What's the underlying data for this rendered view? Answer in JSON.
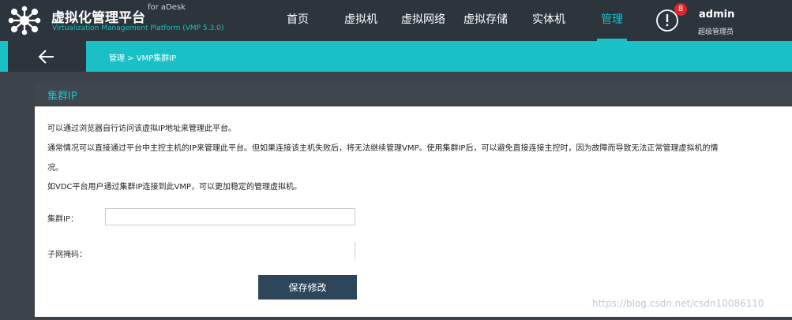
{
  "header": {
    "app_title": "虚拟化管理平台",
    "brand": "for aDesk",
    "subtitle": "Virtualization Management Platform (VMP 5.3.0)",
    "logo_icon": "network-hub-icon",
    "nav": [
      "首页",
      "虚拟机",
      "虚拟网络",
      "虚拟存储",
      "实体机",
      "管理"
    ],
    "active_nav": "管理",
    "alert_count": "8",
    "user_name": "admin",
    "user_role": "超级管理员"
  },
  "subheader": {
    "back_icon": "arrow-left-icon",
    "breadcrumb": "管理 > VMP集群IP"
  },
  "panel": {
    "title": "集群IP",
    "desc_lines": [
      "可以通过浏览器自行访问该虚拟IP地址来管理此平台。",
      "通常情况可以直接通过平台中主控主机的IP来管理此平台。但如果连接该主机失败后，将无法继续管理VMP。使用集群IP后，可以避免直接连接主控时，因为故障而导致无法正常管理虚拟机的情",
      "况。",
      "如VDC平台用户通过集群IP连接到此VMP，可以更加稳定的管理虚拟机。"
    ],
    "cluster_ip_label": "集群IP：",
    "cluster_ip_value": "",
    "netmask_label": "子网掩码：",
    "netmask_value": "",
    "save_label": "保存修改"
  },
  "watermark": "https://blog.csdn.net/csdn10086110",
  "colors": {
    "accent": "#19c1c7",
    "topbar": "#2c343c",
    "button": "#2d4659",
    "badge": "#e0262c"
  }
}
